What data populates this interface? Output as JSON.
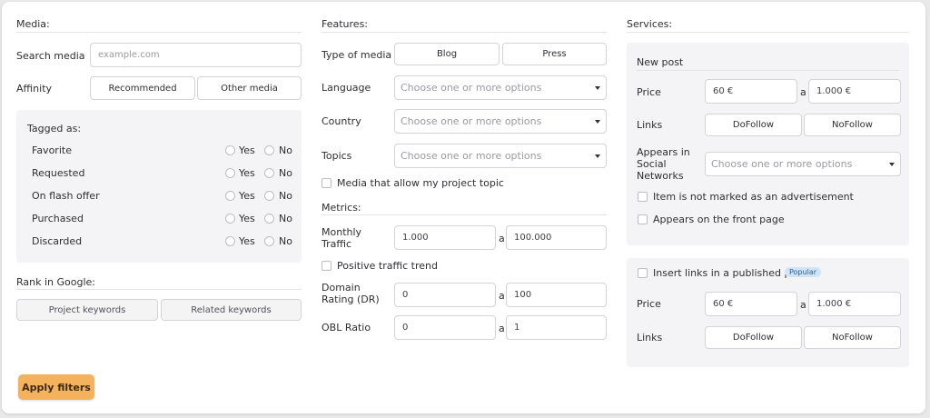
{
  "media": {
    "title": "Media:",
    "search_label": "Search media",
    "search_placeholder": "example.com",
    "affinity_label": "Affinity",
    "affinity_options": [
      "Recommended",
      "Other media"
    ],
    "tagged_title": "Tagged as:",
    "tags": [
      {
        "label": "Favorite",
        "yes": "Yes",
        "no": "No"
      },
      {
        "label": "Requested",
        "yes": "Yes",
        "no": "No"
      },
      {
        "label": "On flash offer",
        "yes": "Yes",
        "no": "No"
      },
      {
        "label": "Purchased",
        "yes": "Yes",
        "no": "No"
      },
      {
        "label": "Discarded",
        "yes": "Yes",
        "no": "No"
      }
    ],
    "rank_title": "Rank in Google:",
    "rank_options": [
      "Project keywords",
      "Related keywords"
    ]
  },
  "features": {
    "title": "Features:",
    "type_label": "Type of media",
    "type_options": [
      "Blog",
      "Press"
    ],
    "language_label": "Language",
    "country_label": "Country",
    "topics_label": "Topics",
    "select_placeholder": "Choose one or more options",
    "project_topic_label": "Media that allow my project topic"
  },
  "metrics": {
    "title": "Metrics:",
    "separator": "a",
    "traffic_label": "Monthly Traffic",
    "traffic_min": "1.000",
    "traffic_max": "100.000",
    "trend_label": "Positive traffic trend",
    "dr_label": "Domain Rating (DR)",
    "dr_min": "0",
    "dr_max": "100",
    "obl_label": "OBL Ratio",
    "obl_min": "0",
    "obl_max": "1"
  },
  "services": {
    "title": "Services:",
    "new_post": {
      "title": "New post",
      "price_label": "Price",
      "price_min": "60 €",
      "price_max": "1.000 €",
      "links_label": "Links",
      "links_options": [
        "DoFollow",
        "NoFollow"
      ],
      "social_label": "Appears in Social Networks",
      "social_placeholder": "Choose one or more options",
      "not_ad_label": "Item is not marked as an advertisement",
      "front_page_label": "Appears on the front page"
    },
    "insert_links": {
      "title": "Insert links in a published post",
      "badge": "Popular",
      "price_label": "Price",
      "price_min": "60 €",
      "price_max": "1.000 €",
      "links_label": "Links",
      "links_options": [
        "DoFollow",
        "NoFollow"
      ]
    }
  },
  "apply_label": "Apply filters",
  "colors": {
    "accent": "#f5b25d",
    "badge_bg": "#cfe4f7"
  }
}
